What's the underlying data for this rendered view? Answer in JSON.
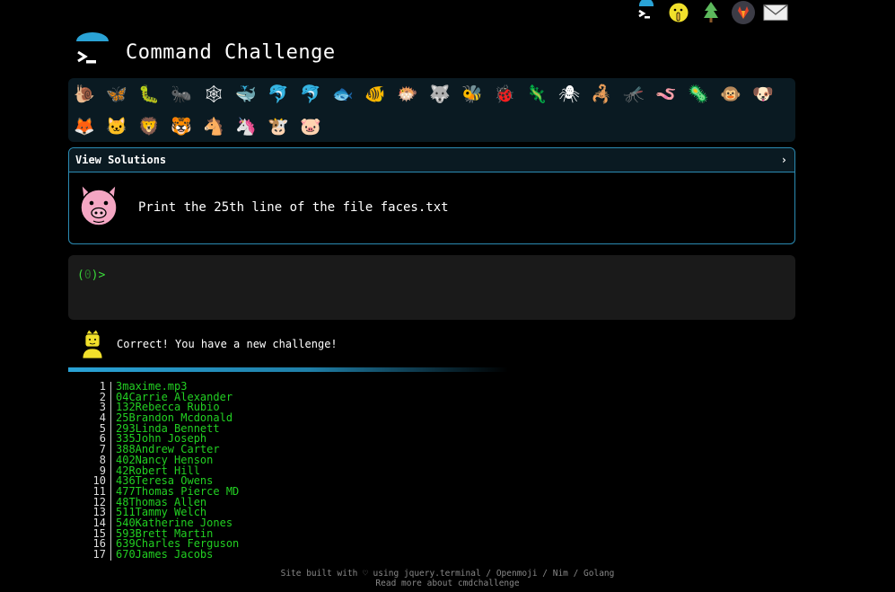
{
  "header": {
    "title": "Command Challenge"
  },
  "top_icons": [
    {
      "name": "cmdchallenge-home-icon",
      "glyph": ">_"
    },
    {
      "name": "face-emoji-icon",
      "glyph": "🤫"
    },
    {
      "name": "tree-icon",
      "glyph": "🌲"
    },
    {
      "name": "gitlab-icon",
      "glyph": "🦊"
    },
    {
      "name": "mail-icon",
      "glyph": "✉"
    }
  ],
  "animals": [
    "🐌",
    "🦋",
    "🐛",
    "🐜",
    "🕸",
    "🐳",
    "🐬",
    "🐬",
    "🐟",
    "🐠",
    "🐡",
    "🐺",
    "🐝",
    "🐞",
    "🦎",
    "🕷",
    "🦂",
    "🦟",
    "🪱",
    "🦠",
    "🐵",
    "🐶",
    "🦊",
    "🐱",
    "🦁",
    "🐯",
    "🐴",
    "🦄",
    "🐮",
    "🐷"
  ],
  "challenge": {
    "view_solutions": "View Solutions",
    "chevron": "›",
    "text": "Print the 25th line of the file faces.txt"
  },
  "terminal": {
    "prompt_open": "(",
    "prompt_num": "0",
    "prompt_close": ")>"
  },
  "result": {
    "message": "Correct! You have a new challenge!"
  },
  "file_lines": [
    {
      "n": "1",
      "t": "3maxime.mp3"
    },
    {
      "n": "2",
      "t": "04Carrie Alexander"
    },
    {
      "n": "3",
      "t": "132Rebecca Rubio"
    },
    {
      "n": "4",
      "t": "25Brandon Mcdonald"
    },
    {
      "n": "5",
      "t": "293Linda Bennett"
    },
    {
      "n": "6",
      "t": "335John Joseph"
    },
    {
      "n": "7",
      "t": "388Andrew Carter"
    },
    {
      "n": "8",
      "t": "402Nancy Henson"
    },
    {
      "n": "9",
      "t": "42Robert Hill"
    },
    {
      "n": "10",
      "t": "436Teresa Owens"
    },
    {
      "n": "11",
      "t": "477Thomas Pierce MD"
    },
    {
      "n": "12",
      "t": "48Thomas Allen"
    },
    {
      "n": "13",
      "t": "511Tammy Welch"
    },
    {
      "n": "14",
      "t": "540Katherine Jones"
    },
    {
      "n": "15",
      "t": "593Brett Martin"
    },
    {
      "n": "16",
      "t": "639Charles Ferguson"
    },
    {
      "n": "17",
      "t": "670James Jacobs"
    }
  ],
  "footer": {
    "line1": "Site built with ♡ using jquery.terminal / Openmoji / Nim / Golang",
    "line2": "Read more about cmdchallenge"
  }
}
